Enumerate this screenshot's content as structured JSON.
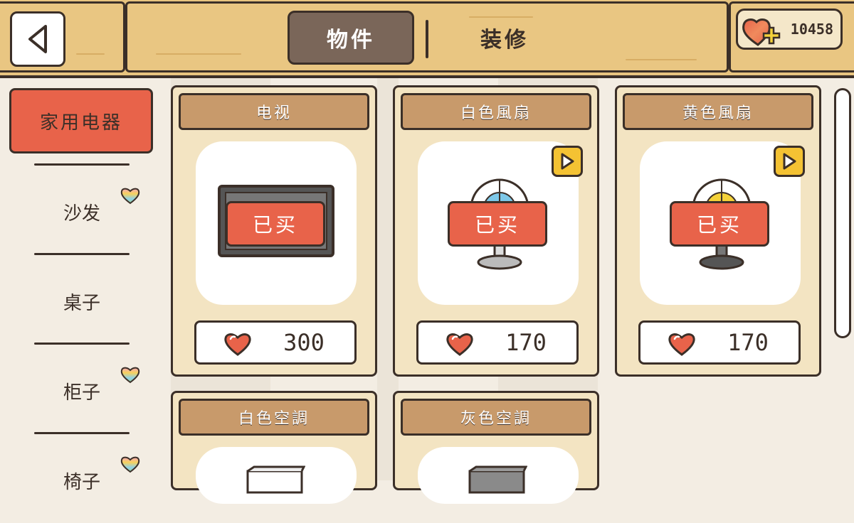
{
  "header": {
    "tabs": [
      {
        "label": "物件",
        "active": true
      },
      {
        "label": "装修",
        "active": false
      }
    ],
    "currency": {
      "icon": "rainbow-heart-plus-icon",
      "amount": "10458"
    }
  },
  "sidebar": {
    "categories": [
      {
        "label": "家用电器",
        "active": true
      },
      {
        "label": "沙发",
        "new_badge": true
      },
      {
        "label": "桌子",
        "new_badge": false
      },
      {
        "label": "柜子",
        "new_badge": true
      },
      {
        "label": "椅子",
        "new_badge": true
      }
    ]
  },
  "items": [
    {
      "name": "电视",
      "status": "已买",
      "price": "300",
      "has_preview": false
    },
    {
      "name": "白色風扇",
      "status": "已买",
      "price": "170",
      "has_preview": true
    },
    {
      "name": "黄色風扇",
      "status": "已买",
      "price": "170",
      "has_preview": true
    },
    {
      "name": "白色空調"
    },
    {
      "name": "灰色空調"
    }
  ],
  "colors": {
    "accent_red": "#e8634a",
    "wood": "#e9c682",
    "card_title_wood": "#c89a6b",
    "outline": "#3b2f28",
    "play_yellow": "#f4c233"
  }
}
